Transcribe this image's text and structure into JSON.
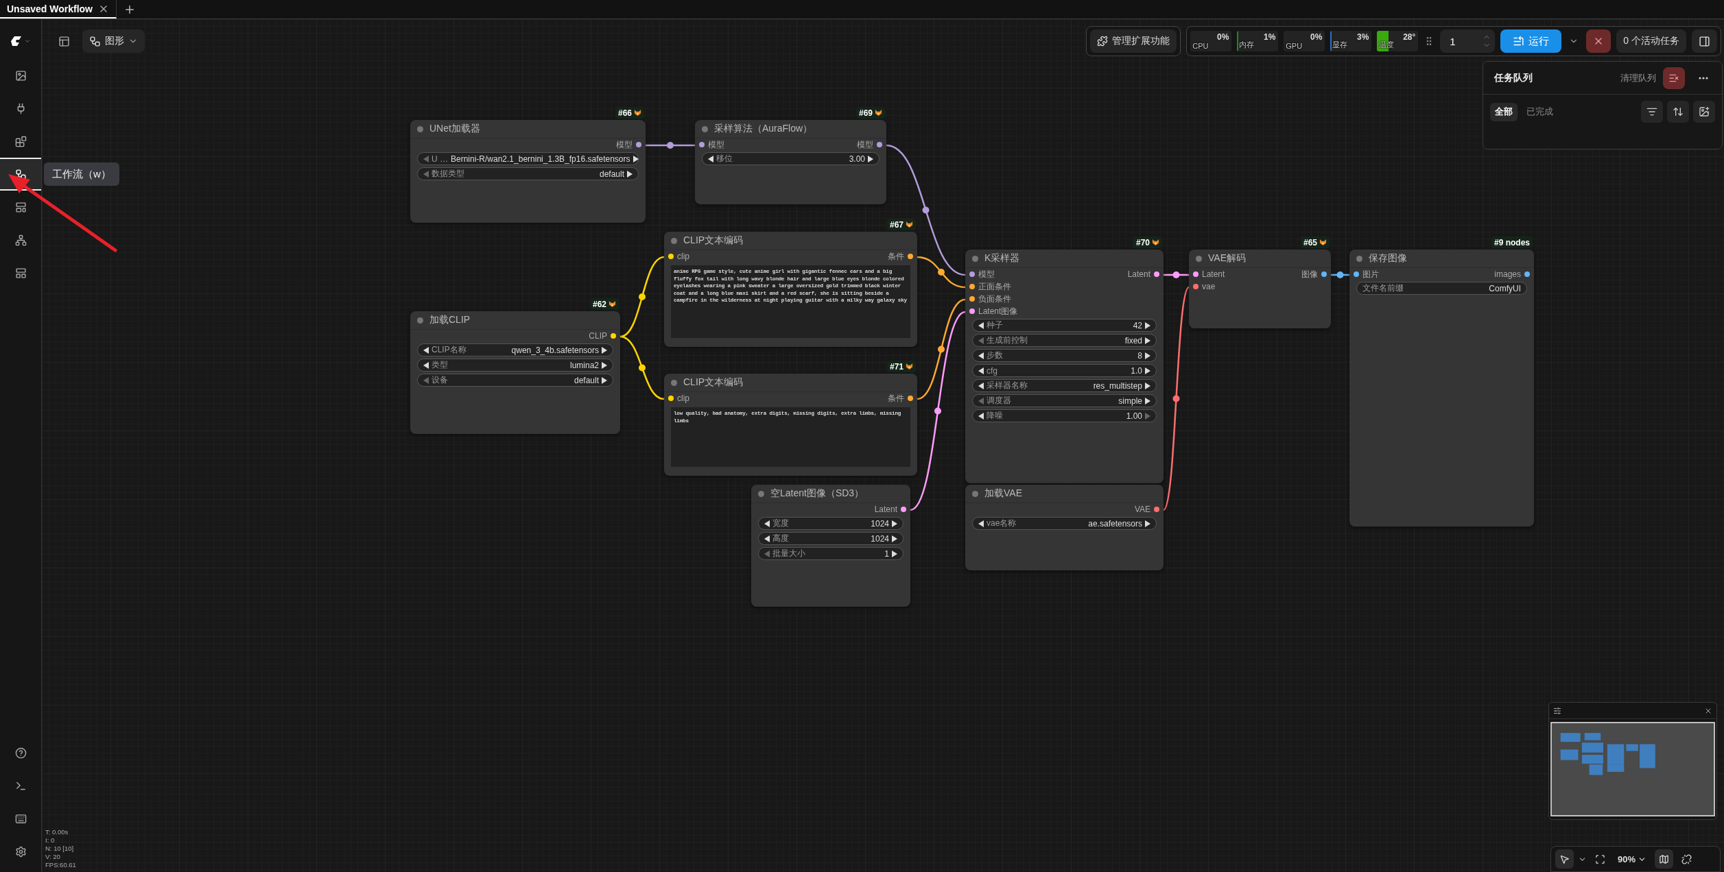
{
  "tabs": [
    {
      "label": "Unsaved Workflow",
      "selected": true
    }
  ],
  "sidebar": {
    "items": [
      {
        "selected": false
      },
      {
        "selected": false
      },
      {
        "selected": false
      },
      {
        "selected": true
      },
      {
        "selected": false
      },
      {
        "selected": false
      },
      {
        "selected": false
      }
    ],
    "tooltip": "工作流（w）"
  },
  "toolbar": {
    "view_button": "图形",
    "extensions_button": "管理扩展功能",
    "monitors": [
      {
        "label": "CPU",
        "reading": "0%"
      },
      {
        "label": "内存",
        "reading": "1%",
        "level": 0.01,
        "color": "#1f8a1f"
      },
      {
        "label": "GPU",
        "reading": "0%"
      },
      {
        "label": "显存",
        "reading": "3%",
        "level": 0.03,
        "color": "#2f6fc0"
      },
      {
        "label": "温度",
        "reading": "28°",
        "level": 0.28,
        "color": "#3aa80f"
      }
    ],
    "batch_count": "1",
    "run_button": "运行",
    "active_tasks_button": "0 个活动任务"
  },
  "queue_panel": {
    "title": "任务队列",
    "clear_button": "清理队列",
    "filters": [
      {
        "label": "全部",
        "selected": true
      },
      {
        "label": "已完成",
        "selected": false
      }
    ]
  },
  "nodes": [
    {
      "badge": "#66",
      "fox_badge": true,
      "title": "UNet加载器",
      "outputs": [
        {
          "name": "模型",
          "color": "#b39ddb"
        }
      ],
      "widgets": [
        {
          "kind": "combo",
          "label": "U …",
          "value": "Bernini-R/wan2.1_bernini_1.3B_fp16.safetensors",
          "prev_disabled": true,
          "next_disabled": false
        },
        {
          "kind": "combo",
          "label": "数据类型",
          "value": "default",
          "prev_disabled": true,
          "next_disabled": false
        }
      ]
    },
    {
      "badge": "#69",
      "fox_badge": true,
      "title": "采样算法（AuraFlow）",
      "inputs": [
        {
          "name": "模型",
          "color": "#b39ddb"
        }
      ],
      "outputs": [
        {
          "name": "模型",
          "color": "#b39ddb"
        }
      ],
      "widgets": [
        {
          "kind": "number",
          "label": "移位",
          "value": "3.00",
          "prev_disabled": false,
          "next_disabled": false
        }
      ]
    },
    {
      "badge": "#67",
      "fox_badge": true,
      "title": "CLIP文本编码",
      "inputs": [
        {
          "name": "clip",
          "color": "#ffd500"
        }
      ],
      "outputs": [
        {
          "name": "条件",
          "color": "#ffa931"
        }
      ],
      "prompt": "anime RPG game style, cute anime girl with gigantic fennec ears and a big fluffy fox tail with long wavy blonde hair and large blue eyes blonde colored eyelashes wearing a pink sweater a large oversized gold trimmed black winter coat and a long blue maxi skirt and a red scarf, she is sitting beside a campfire in the wilderness at night playing guitar with a milky way galaxy sky"
    },
    {
      "badge": "#71",
      "fox_badge": true,
      "title": "CLIP文本编码",
      "inputs": [
        {
          "name": "clip",
          "color": "#ffd500"
        }
      ],
      "outputs": [
        {
          "name": "条件",
          "color": "#ffa931"
        }
      ],
      "prompt": "low quality, bad anatomy, extra digits, missing digits, extra limbs, missing limbs"
    },
    {
      "badge": "#62",
      "fox_badge": true,
      "title": "加载CLIP",
      "outputs": [
        {
          "name": "CLIP",
          "color": "#ffd500"
        }
      ],
      "widgets": [
        {
          "kind": "combo",
          "label": "CLIP名称",
          "value": "qwen_3_4b.safetensors",
          "prev_disabled": false,
          "next_disabled": false
        },
        {
          "kind": "combo",
          "label": "类型",
          "value": "lumina2",
          "prev_disabled": false,
          "next_disabled": false
        },
        {
          "kind": "combo",
          "label": "设备",
          "value": "default",
          "prev_disabled": true,
          "next_disabled": false
        }
      ]
    },
    {
      "title": "空Latent图像（SD3）",
      "outputs": [
        {
          "name": "Latent",
          "color": "#ff9cf9"
        }
      ],
      "widgets": [
        {
          "kind": "number",
          "label": "宽度",
          "value": "1024",
          "prev_disabled": false,
          "next_disabled": false
        },
        {
          "kind": "number",
          "label": "高度",
          "value": "1024",
          "prev_disabled": false,
          "next_disabled": false
        },
        {
          "kind": "number",
          "label": "批量大小",
          "value": "1",
          "prev_disabled": true,
          "next_disabled": false
        }
      ]
    },
    {
      "badge": "#70",
      "fox_badge": true,
      "title": "K采样器",
      "inputs": [
        {
          "name": "模型",
          "color": "#b39ddb"
        },
        {
          "name": "正面条件",
          "color": "#ffa931"
        },
        {
          "name": "负面条件",
          "color": "#ffa931"
        },
        {
          "name": "Latent图像",
          "color": "#ff9cf9"
        }
      ],
      "outputs": [
        {
          "name": "Latent",
          "color": "#ff9cf9"
        }
      ],
      "widgets": [
        {
          "kind": "number",
          "label": "种子",
          "value": "42",
          "prev_disabled": false,
          "next_disabled": false
        },
        {
          "kind": "combo",
          "label": "生成前控制",
          "value": "fixed",
          "prev_disabled": true,
          "next_disabled": false
        },
        {
          "kind": "number",
          "label": "步数",
          "value": "8",
          "prev_disabled": false,
          "next_disabled": false
        },
        {
          "kind": "number",
          "label": "cfg",
          "value": "1.0",
          "prev_disabled": false,
          "next_disabled": false
        },
        {
          "kind": "combo",
          "label": "采样器名称",
          "value": "res_multistep",
          "prev_disabled": false,
          "next_disabled": false
        },
        {
          "kind": "combo",
          "label": "调度器",
          "value": "simple",
          "prev_disabled": true,
          "next_disabled": false
        },
        {
          "kind": "number",
          "label": "降噪",
          "value": "1.00",
          "prev_disabled": false,
          "next_disabled": true
        }
      ]
    },
    {
      "title": "加载VAE",
      "outputs": [
        {
          "name": "VAE",
          "color": "#ff6e6e"
        }
      ],
      "widgets": [
        {
          "kind": "combo",
          "label": "vae名称",
          "value": "ae.safetensors",
          "prev_disabled": false,
          "next_disabled": false
        }
      ]
    },
    {
      "badge": "#65",
      "fox_badge": true,
      "title": "VAE解码",
      "inputs": [
        {
          "name": "Latent",
          "color": "#ff9cf9"
        },
        {
          "name": "vae",
          "color": "#ff6e6e"
        }
      ],
      "outputs": [
        {
          "name": "图像",
          "color": "#64b5f6"
        }
      ]
    },
    {
      "badge": "#9 nodes",
      "fox_badge": false,
      "title": "保存图像",
      "inputs": [
        {
          "name": "图片",
          "color": "#64b5f6"
        }
      ],
      "outputs": [
        {
          "name": "images",
          "color": "#64b5f6"
        }
      ],
      "widgets": [
        {
          "kind": "text",
          "label": "文件名前缀",
          "value": "ComfyUI"
        }
      ]
    }
  ],
  "stats": [
    "T: 0.00s",
    "I: 0",
    "N: 10 [10]",
    "V: 20",
    "FPS:60.61"
  ],
  "zoom": {
    "reading": "90%"
  }
}
